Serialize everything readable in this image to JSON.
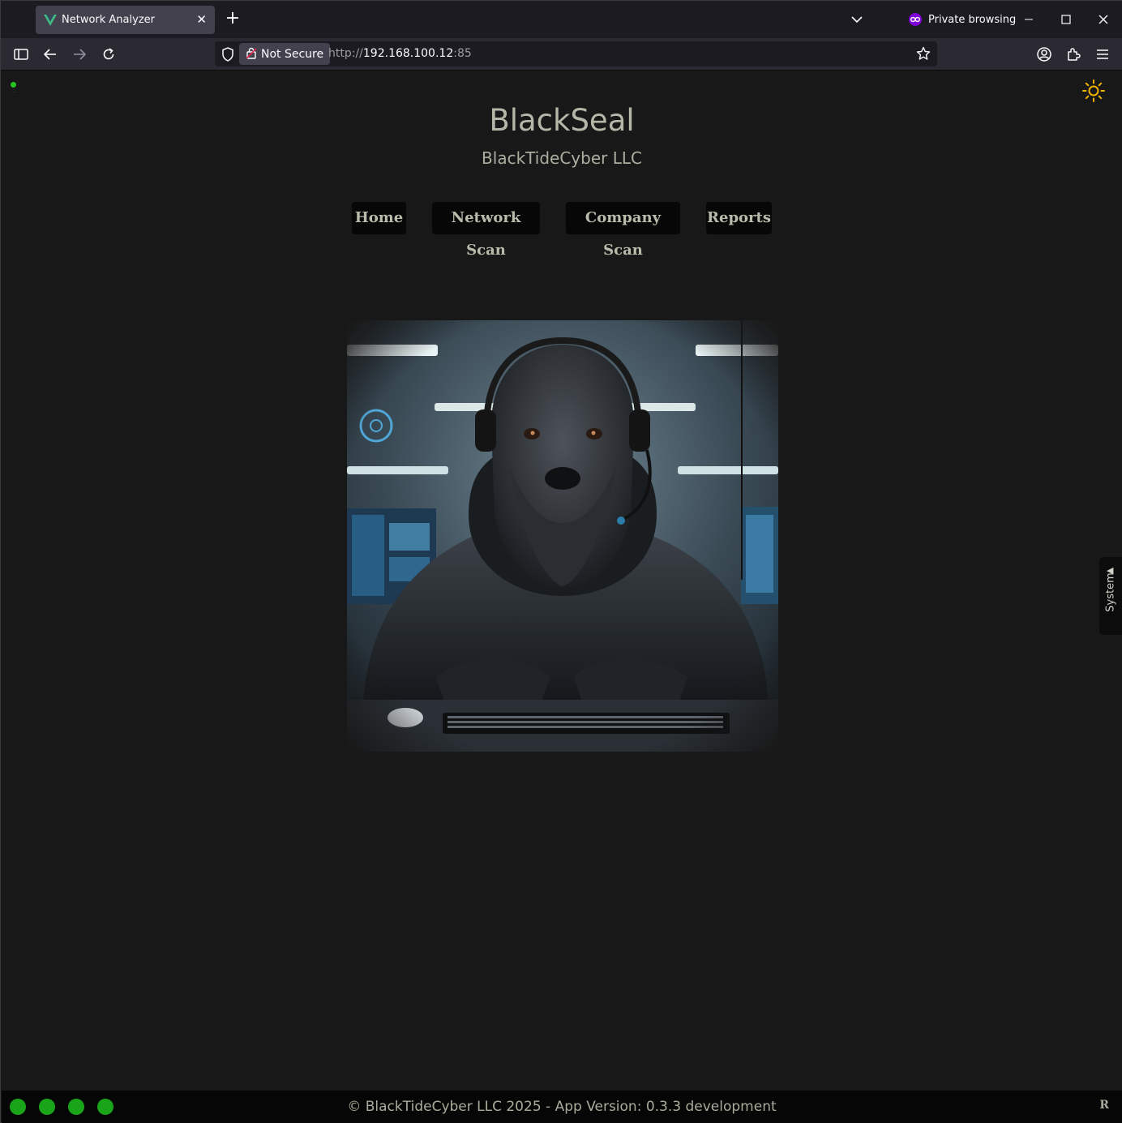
{
  "browser": {
    "tab_title": "Network Analyzer",
    "private_label": "Private browsing",
    "security_label": "Not Secure",
    "url_scheme": "http://",
    "url_host": "192.168.100.12",
    "url_port": ":85"
  },
  "header": {
    "brand": "BlackSeal",
    "company": "BlackTideCyber LLC"
  },
  "menu": {
    "items": [
      {
        "label": "Home"
      },
      {
        "label": "Network Scan"
      },
      {
        "label": "Company Scan"
      },
      {
        "label": "Reports"
      }
    ]
  },
  "side_panel": {
    "label": "System"
  },
  "footer": {
    "copyright": "© BlackTideCyber LLC 2025 - App Version: 0.3.3 development",
    "corner_badge": "R",
    "status_dot_color": "#1aa41a"
  },
  "icons": {
    "theme": "sun-icon",
    "hero": "seal-hacker-illustration"
  },
  "colors": {
    "page_bg": "#181818",
    "accent_sun": "#f0b400",
    "status_green": "#22c322"
  }
}
